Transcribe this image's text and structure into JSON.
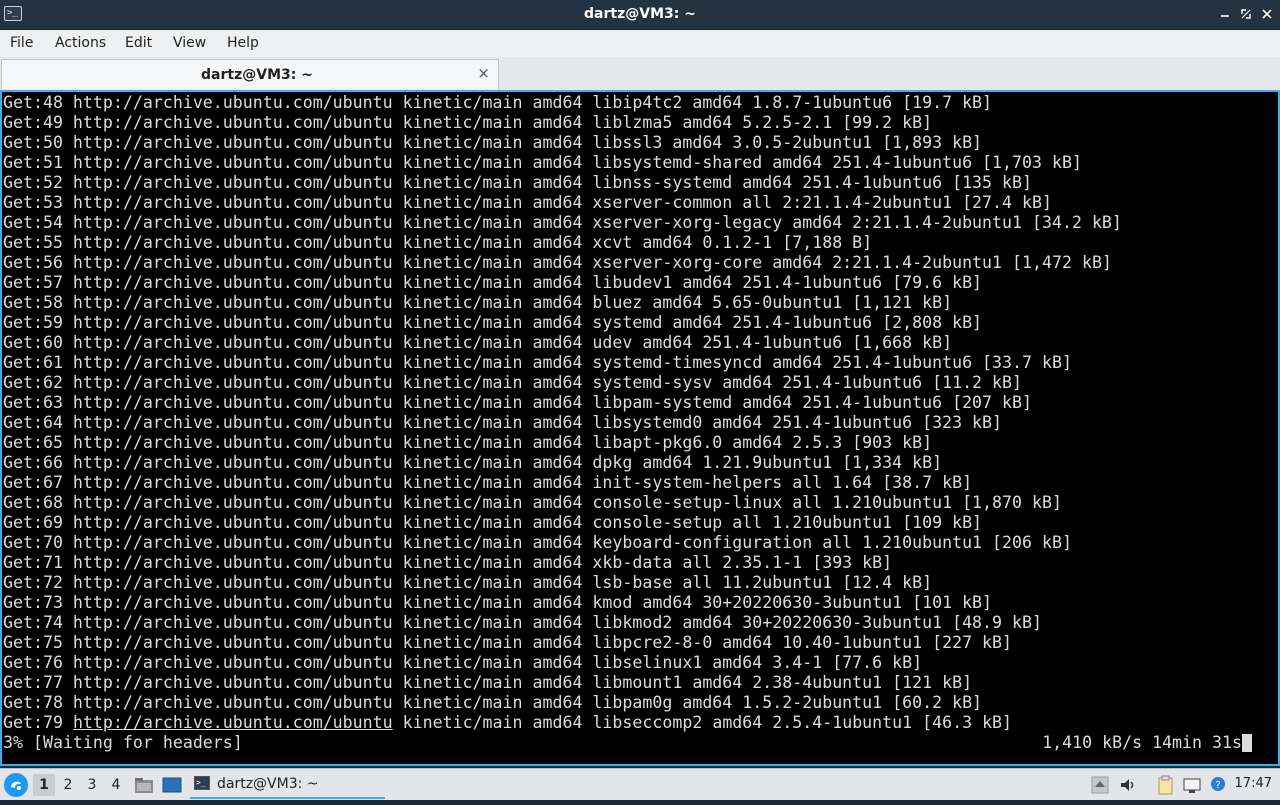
{
  "window": {
    "title": "dartz@VM3: ~",
    "app_icon_glyph": ">_"
  },
  "menu": {
    "file": "File",
    "actions": "Actions",
    "edit": "Edit",
    "view": "View",
    "help": "Help"
  },
  "tab": {
    "label": "dartz@VM3: ~",
    "close_glyph": "×"
  },
  "terminal": {
    "lines": [
      "Get:48 http://archive.ubuntu.com/ubuntu kinetic/main amd64 libip4tc2 amd64 1.8.7-1ubuntu6 [19.7 kB]",
      "Get:49 http://archive.ubuntu.com/ubuntu kinetic/main amd64 liblzma5 amd64 5.2.5-2.1 [99.2 kB]",
      "Get:50 http://archive.ubuntu.com/ubuntu kinetic/main amd64 libssl3 amd64 3.0.5-2ubuntu1 [1,893 kB]",
      "Get:51 http://archive.ubuntu.com/ubuntu kinetic/main amd64 libsystemd-shared amd64 251.4-1ubuntu6 [1,703 kB]",
      "Get:52 http://archive.ubuntu.com/ubuntu kinetic/main amd64 libnss-systemd amd64 251.4-1ubuntu6 [135 kB]",
      "Get:53 http://archive.ubuntu.com/ubuntu kinetic/main amd64 xserver-common all 2:21.1.4-2ubuntu1 [27.4 kB]",
      "Get:54 http://archive.ubuntu.com/ubuntu kinetic/main amd64 xserver-xorg-legacy amd64 2:21.1.4-2ubuntu1 [34.2 kB]",
      "Get:55 http://archive.ubuntu.com/ubuntu kinetic/main amd64 xcvt amd64 0.1.2-1 [7,188 B]",
      "Get:56 http://archive.ubuntu.com/ubuntu kinetic/main amd64 xserver-xorg-core amd64 2:21.1.4-2ubuntu1 [1,472 kB]",
      "Get:57 http://archive.ubuntu.com/ubuntu kinetic/main amd64 libudev1 amd64 251.4-1ubuntu6 [79.6 kB]",
      "Get:58 http://archive.ubuntu.com/ubuntu kinetic/main amd64 bluez amd64 5.65-0ubuntu1 [1,121 kB]",
      "Get:59 http://archive.ubuntu.com/ubuntu kinetic/main amd64 systemd amd64 251.4-1ubuntu6 [2,808 kB]",
      "Get:60 http://archive.ubuntu.com/ubuntu kinetic/main amd64 udev amd64 251.4-1ubuntu6 [1,668 kB]",
      "Get:61 http://archive.ubuntu.com/ubuntu kinetic/main amd64 systemd-timesyncd amd64 251.4-1ubuntu6 [33.7 kB]",
      "Get:62 http://archive.ubuntu.com/ubuntu kinetic/main amd64 systemd-sysv amd64 251.4-1ubuntu6 [11.2 kB]",
      "Get:63 http://archive.ubuntu.com/ubuntu kinetic/main amd64 libpam-systemd amd64 251.4-1ubuntu6 [207 kB]",
      "Get:64 http://archive.ubuntu.com/ubuntu kinetic/main amd64 libsystemd0 amd64 251.4-1ubuntu6 [323 kB]",
      "Get:65 http://archive.ubuntu.com/ubuntu kinetic/main amd64 libapt-pkg6.0 amd64 2.5.3 [903 kB]",
      "Get:66 http://archive.ubuntu.com/ubuntu kinetic/main amd64 dpkg amd64 1.21.9ubuntu1 [1,334 kB]",
      "Get:67 http://archive.ubuntu.com/ubuntu kinetic/main amd64 init-system-helpers all 1.64 [38.7 kB]",
      "Get:68 http://archive.ubuntu.com/ubuntu kinetic/main amd64 console-setup-linux all 1.210ubuntu1 [1,870 kB]",
      "Get:69 http://archive.ubuntu.com/ubuntu kinetic/main amd64 console-setup all 1.210ubuntu1 [109 kB]",
      "Get:70 http://archive.ubuntu.com/ubuntu kinetic/main amd64 keyboard-configuration all 1.210ubuntu1 [206 kB]",
      "Get:71 http://archive.ubuntu.com/ubuntu kinetic/main amd64 xkb-data all 2.35.1-1 [393 kB]",
      "Get:72 http://archive.ubuntu.com/ubuntu kinetic/main amd64 lsb-base all 11.2ubuntu1 [12.4 kB]",
      "Get:73 http://archive.ubuntu.com/ubuntu kinetic/main amd64 kmod amd64 30+20220630-3ubuntu1 [101 kB]",
      "Get:74 http://archive.ubuntu.com/ubuntu kinetic/main amd64 libkmod2 amd64 30+20220630-3ubuntu1 [48.9 kB]",
      "Get:75 http://archive.ubuntu.com/ubuntu kinetic/main amd64 libpcre2-8-0 amd64 10.40-1ubuntu1 [227 kB]",
      "Get:76 http://archive.ubuntu.com/ubuntu kinetic/main amd64 libselinux1 amd64 3.4-1 [77.6 kB]",
      "Get:77 http://archive.ubuntu.com/ubuntu kinetic/main amd64 libmount1 amd64 2.38-4ubuntu1 [121 kB]",
      "Get:78 http://archive.ubuntu.com/ubuntu kinetic/main amd64 libpam0g amd64 1.5.2-2ubuntu1 [60.2 kB]"
    ],
    "last_line": {
      "prefix": "Get:79 ",
      "url": "http://archive.ubuntu.com/ubuntu",
      "suffix": " kinetic/main amd64 libseccomp2 amd64 2.5.4-1ubuntu1 [46.3 kB]"
    },
    "status_left": "3% [Waiting for headers]",
    "status_right": "1,410 kB/s 14min 31s",
    "progress_percent": 3
  },
  "taskbar": {
    "workspaces": [
      "1",
      "2",
      "3",
      "4"
    ],
    "active_workspace": "1",
    "task_label": "dartz@VM3: ~",
    "clock": "17:47"
  },
  "colors": {
    "titlebar_bg": "#243341",
    "terminal_bg": "#000000",
    "terminal_fg": "#dcdcdc",
    "focus_border": "#3daee9",
    "start_button": "#1d99f3"
  },
  "icons": {
    "app": "terminal-icon",
    "minimize": "minimize-icon",
    "maximize": "maximize-icon",
    "close": "close-icon",
    "start": "start-menu-icon",
    "file_manager": "file-manager-icon",
    "show_desktop": "show-desktop-icon",
    "tray_up": "tray-arrow-up-icon",
    "volume": "volume-icon",
    "clipboard": "clipboard-icon",
    "network": "network-icon",
    "notifications": "notification-icon"
  }
}
